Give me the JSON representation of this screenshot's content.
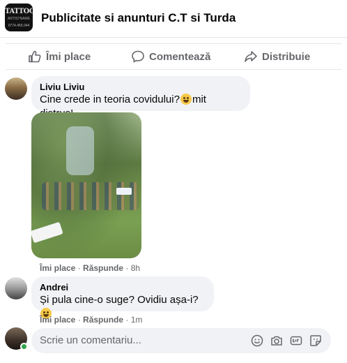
{
  "group": {
    "name": "Publicitate si anunturi C.T si Turda",
    "avatar_logo_text": "TATTOO",
    "avatar_logo_sub": "ARTISTNAME",
    "avatar_logo_phone": "0774.455.044"
  },
  "actions": {
    "like_label": "Îmi place",
    "comment_label": "Comentează",
    "share_label": "Distribuie"
  },
  "comments": [
    {
      "author": "Liviu Liviu",
      "text_before": "Cine crede in teoria covidului?",
      "text_after": "mit distrus!",
      "like_label": "Îmi place",
      "reply_label": "Răspunde",
      "time": "8h"
    },
    {
      "author": "Andrei",
      "text_before": "Și pula cine-o suge? Ovidiu așa-i?",
      "text_after": "",
      "like_label": "Îmi place",
      "reply_label": "Răspunde",
      "time": "1m"
    }
  ],
  "composer": {
    "placeholder": "Scrie un comentariu..."
  },
  "icons": [
    "like-icon",
    "comment-icon",
    "share-icon",
    "emoji-icon",
    "camera-icon",
    "gif-icon",
    "sticker-icon"
  ]
}
